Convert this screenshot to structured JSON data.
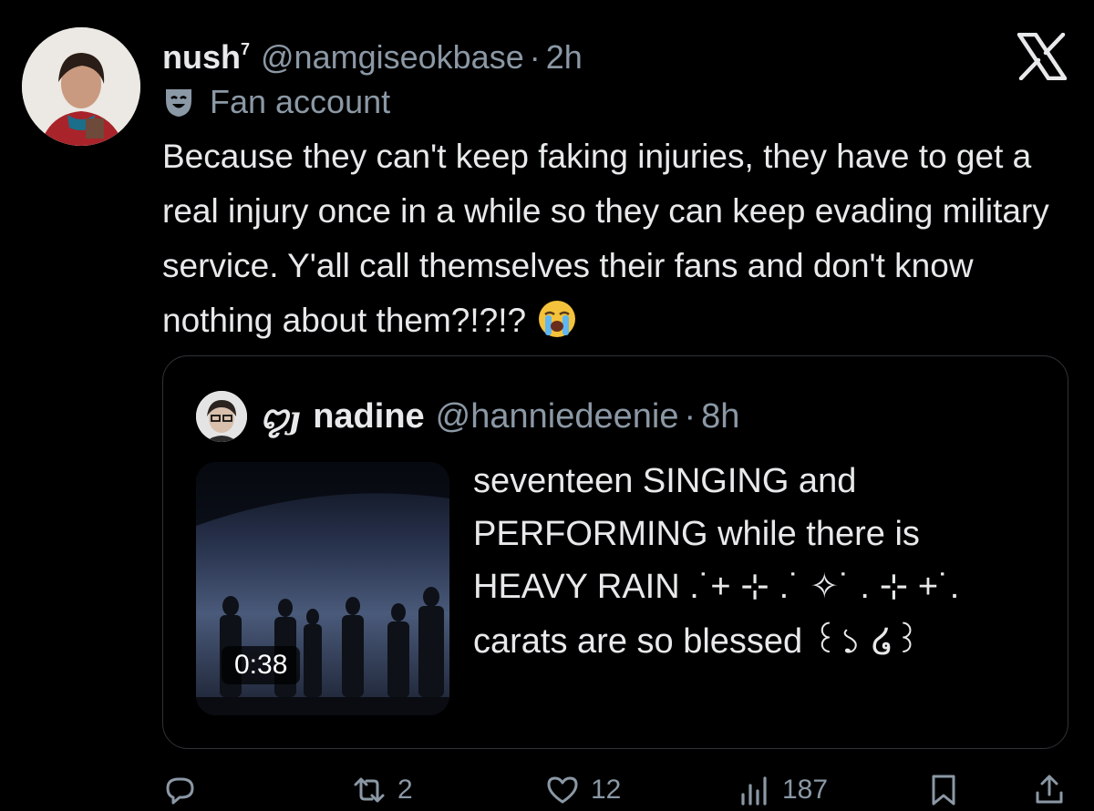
{
  "tweet": {
    "display_name": "nush",
    "name_superscript": "7",
    "handle": "@namgiseokbase",
    "separator": "·",
    "time": "2h",
    "label": "Fan account",
    "text": "Because they can't keep faking injuries, they have to get a real injury once in a while so they can keep evading military service. Y'all call themselves their fans and don't know nothing about them?!?!?",
    "emoji": "loudly-crying-face"
  },
  "quote": {
    "decoration": "ꨄȷ",
    "display_name": "nadine",
    "handle": "@hanniedeenie",
    "separator": "·",
    "time": "8h",
    "video_duration": "0:38",
    "text_line1": "seventeen SINGING and\nPERFORMING while there is\nHEAVY RAIN .˙+ ⊹ .˙ ✧˙ . ⊹ +˙.",
    "text_line2": "carats are so blessed ꒰১ ໒꒱"
  },
  "actions": {
    "reply_count": "",
    "retweet_count": "2",
    "like_count": "12",
    "views_count": "187"
  },
  "colors": {
    "background": "#000000",
    "text": "#e7e9ea",
    "secondary": "#8b98a5",
    "border": "#2f3336"
  }
}
